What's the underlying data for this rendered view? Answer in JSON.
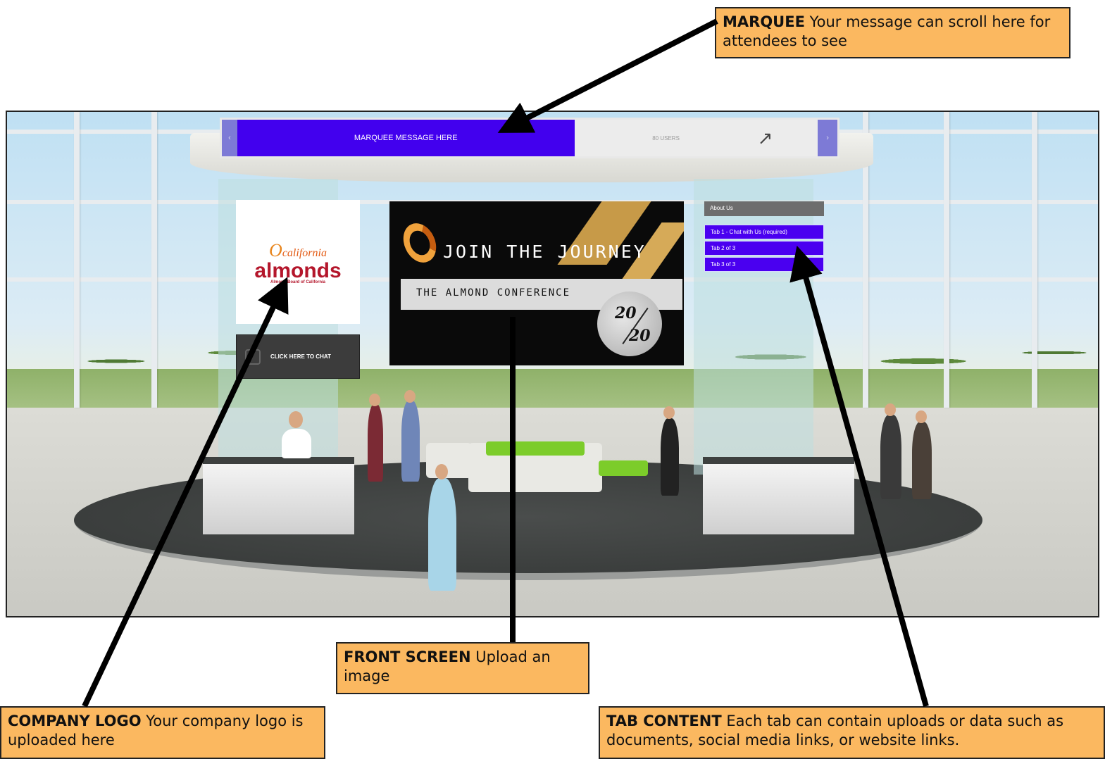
{
  "callouts": {
    "marquee": {
      "title": "MARQUEE",
      "text": " Your message can scroll here for attendees to see"
    },
    "front_screen": {
      "title": "FRONT SCREEN",
      "text": " Upload an image"
    },
    "company_logo": {
      "title": "COMPANY LOGO",
      "text": " Your company logo is uploaded here"
    },
    "tab_content": {
      "title": "TAB CONTENT",
      "text": " Each tab can contain uploads or data such as documents, social media links, or website links."
    }
  },
  "booth": {
    "marquee": {
      "prev": "‹",
      "message": "MARQUEE MESSAGE HERE",
      "users": "80 USERS",
      "external_icon": "external-link-icon",
      "next": "›"
    },
    "logo": {
      "brand_top": "california",
      "brand_main": "almonds",
      "brand_sub": "Almond Board of California"
    },
    "chat_button": "CLICK HERE TO CHAT",
    "front_screen": {
      "title": "JOIN THE JOURNEY",
      "subtitle": "THE ALMOND CONFERENCE",
      "year_top": "20",
      "year_bottom": "20"
    },
    "tabs": {
      "about": "About Us",
      "items": [
        "Tab 1 - Chat with Us (required)",
        "Tab 2 of 3",
        "Tab 3 of 3"
      ]
    }
  },
  "colors": {
    "callout_bg": "#fbb860",
    "marquee_bg": "#4200ee",
    "tab_bg": "#4a00f0"
  }
}
